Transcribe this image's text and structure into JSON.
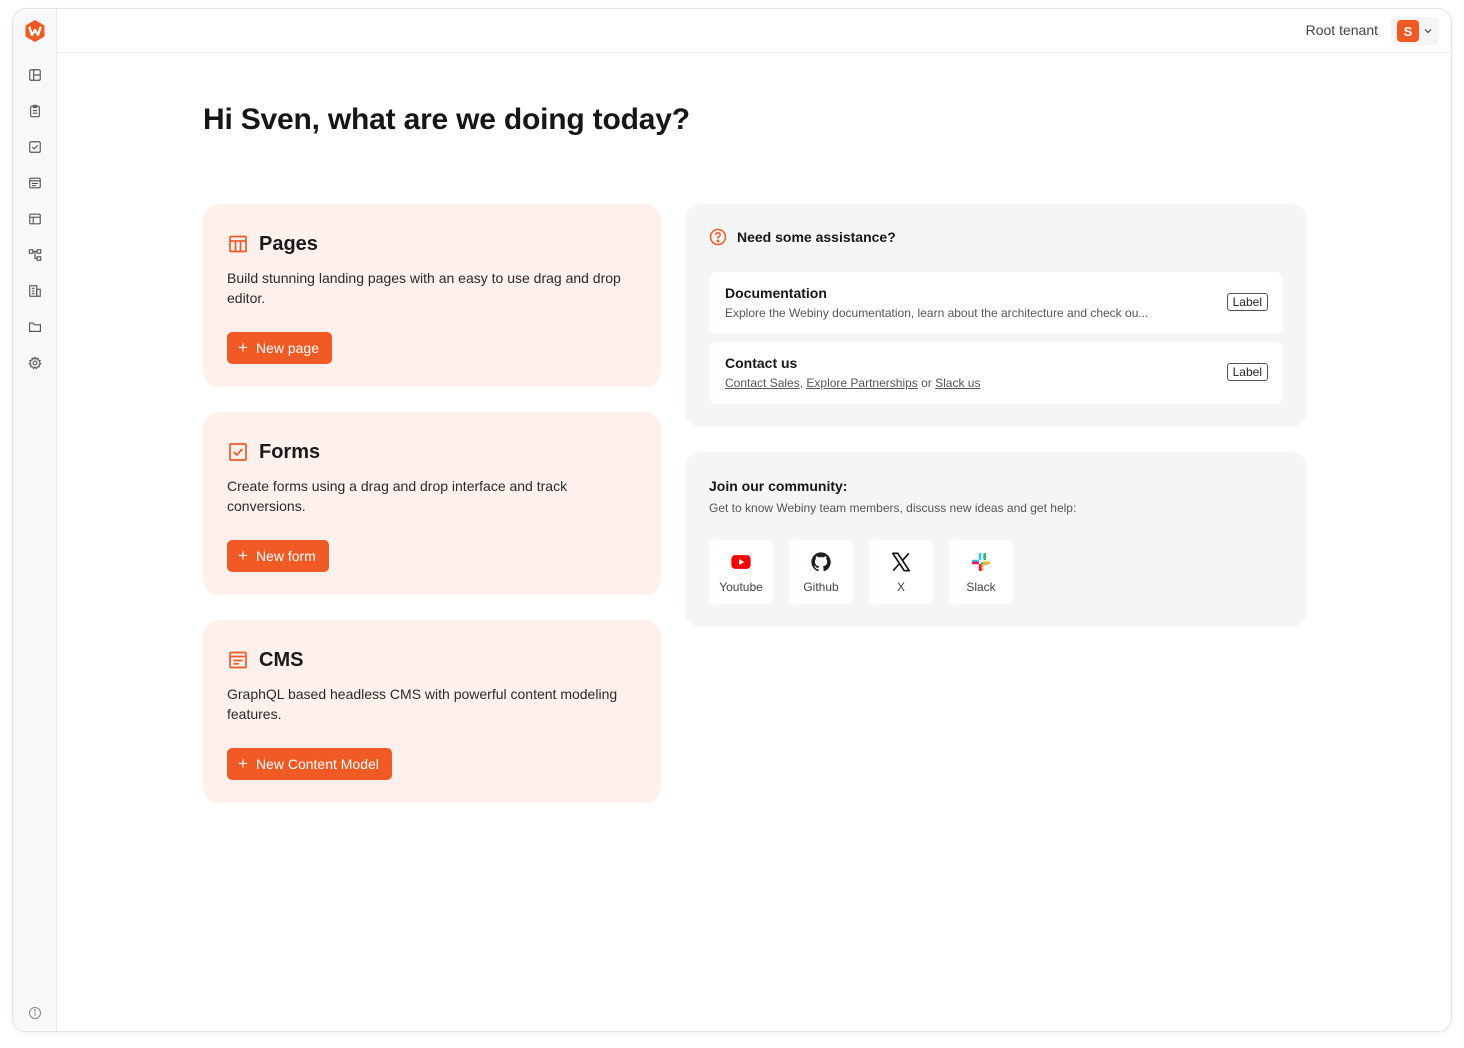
{
  "header": {
    "tenant": "Root tenant",
    "user_initial": "S",
    "accent": "#f15a24"
  },
  "sidebar": {
    "items": [
      {
        "icon": "layout-icon"
      },
      {
        "icon": "clipboard-icon"
      },
      {
        "icon": "checkbox-icon"
      },
      {
        "icon": "cms-icon"
      },
      {
        "icon": "table-icon"
      },
      {
        "icon": "tree-icon"
      },
      {
        "icon": "building-icon"
      },
      {
        "icon": "folder-icon"
      },
      {
        "icon": "settings-icon"
      }
    ],
    "footer_icon": "info-icon"
  },
  "main": {
    "greeting": "Hi Sven, what are we doing today?",
    "cards": [
      {
        "title": "Pages",
        "description": "Build stunning landing pages with an easy to use drag and drop editor.",
        "button": "New page",
        "icon": "pages-icon"
      },
      {
        "title": "Forms",
        "description": "Create forms using a drag and drop interface and track conversions.",
        "button": "New form",
        "icon": "forms-icon"
      },
      {
        "title": "CMS",
        "description": "GraphQL based headless CMS with powerful content modeling features.",
        "button": "New Content Model",
        "icon": "cms-icon"
      }
    ],
    "assistance": {
      "title": "Need some assistance?",
      "items": [
        {
          "title": "Documentation",
          "description": "Explore the Webiny documentation, learn about the architecture and check ou...",
          "badge": "Label"
        },
        {
          "title": "Contact us",
          "links": [
            "Contact Sales",
            "Explore Partnerships",
            "Slack us"
          ],
          "sep1": ", ",
          "sep2": " or ",
          "badge": "Label"
        }
      ]
    },
    "community": {
      "title": "Join our community:",
      "subtitle": "Get to know Webiny team members, discuss new ideas and get help:",
      "links": [
        {
          "label": "Youtube",
          "icon": "youtube-icon"
        },
        {
          "label": "Github",
          "icon": "github-icon"
        },
        {
          "label": "X",
          "icon": "x-icon"
        },
        {
          "label": "Slack",
          "icon": "slack-icon"
        }
      ]
    }
  }
}
